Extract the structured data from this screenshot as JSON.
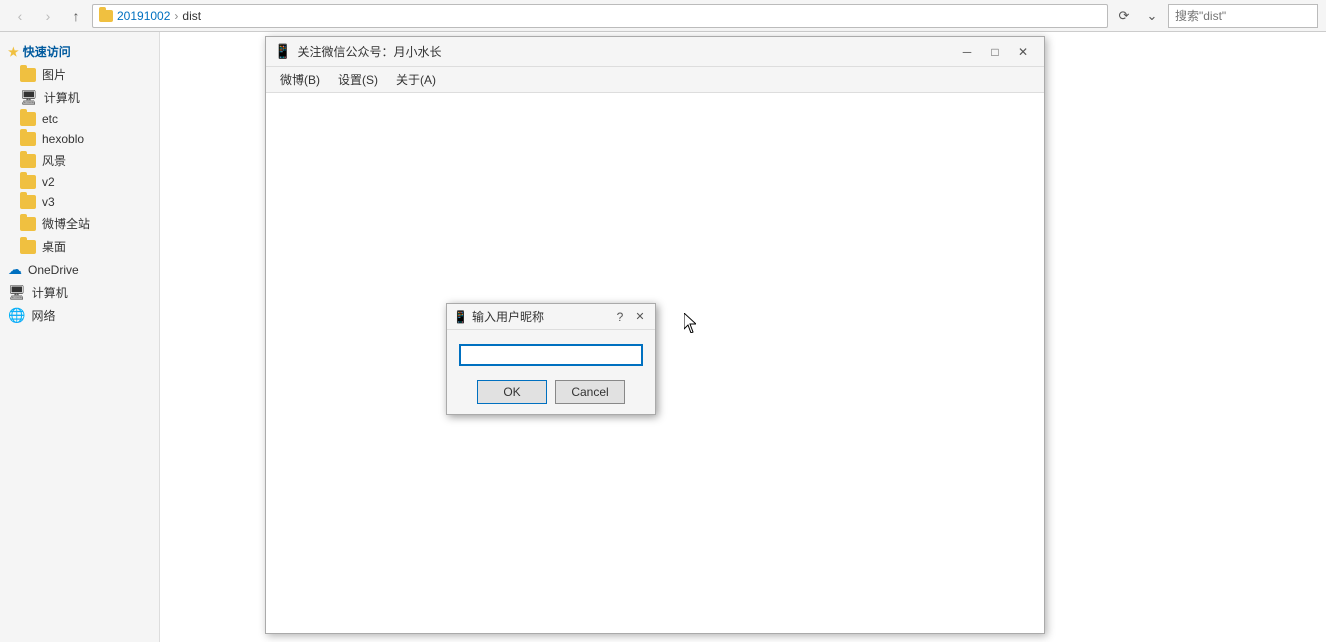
{
  "nav": {
    "back_label": "←",
    "forward_label": "→",
    "up_label": "↑",
    "breadcrumb": {
      "part1": "20191002",
      "part2": "dist"
    },
    "search_placeholder": "搜索\"dist\""
  },
  "sidebar": {
    "quick_access_label": "快速访问",
    "items": [
      {
        "id": "pictures",
        "label": "图片",
        "icon": "folder"
      },
      {
        "id": "computer",
        "label": "计算机",
        "icon": "computer"
      },
      {
        "id": "etc",
        "label": "etc",
        "icon": "folder"
      },
      {
        "id": "hexoblo",
        "label": "hexoblo",
        "icon": "folder"
      },
      {
        "id": "scenery",
        "label": "风景",
        "icon": "folder"
      },
      {
        "id": "v2",
        "label": "v2",
        "icon": "folder"
      },
      {
        "id": "v3",
        "label": "v3",
        "icon": "folder"
      },
      {
        "id": "weibo_all",
        "label": "微博全站",
        "icon": "folder"
      },
      {
        "id": "desktop",
        "label": "桌面",
        "icon": "folder"
      },
      {
        "id": "onedrive",
        "label": "OneDrive",
        "icon": "onedrive"
      },
      {
        "id": "this_pc",
        "label": "计算机",
        "icon": "computer"
      },
      {
        "id": "network",
        "label": "网络",
        "icon": "network"
      }
    ]
  },
  "app_window": {
    "title": "关注微信公众号：月小水长",
    "title_icon": "📱",
    "menu": {
      "items": [
        "微博(B)",
        "设置(S)",
        "关于(A)"
      ]
    },
    "minimize_label": "─",
    "maximize_label": "□",
    "close_label": "✕"
  },
  "dialog": {
    "title": "输入用户昵称",
    "title_icon": "📱",
    "help_label": "?",
    "close_label": "✕",
    "input_value": "",
    "input_placeholder": "",
    "ok_label": "OK",
    "cancel_label": "Cancel"
  }
}
